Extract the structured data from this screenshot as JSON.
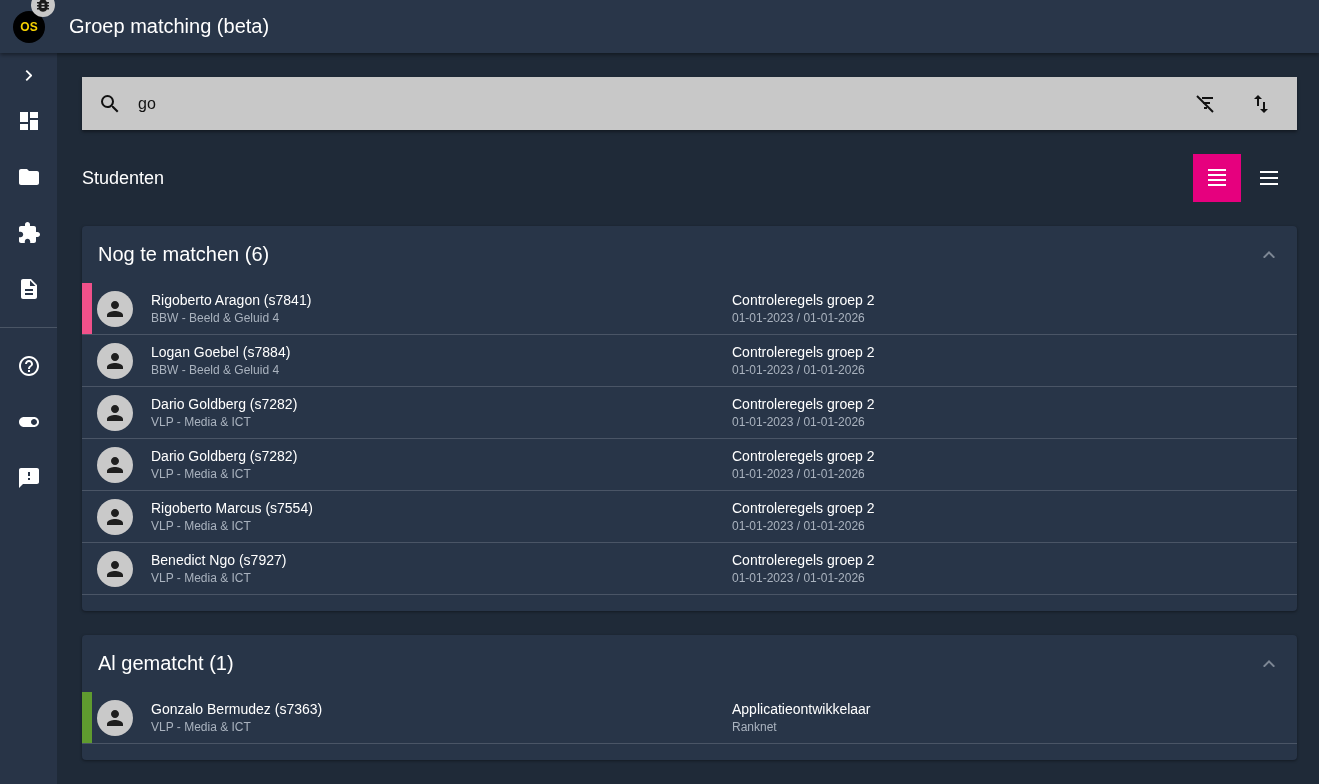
{
  "header": {
    "logo": "OS",
    "title": "Groep matching (beta)"
  },
  "search": {
    "value": "go"
  },
  "section_title": "Studenten",
  "view_toggle": [
    {
      "kind": "dense",
      "selected": true
    },
    {
      "kind": "list",
      "selected": false
    }
  ],
  "groups": [
    {
      "title": "Nog te matchen (6)",
      "expanded": true,
      "rows": [
        {
          "name": "Rigoberto Aragon (s7841)",
          "program": "BBW - Beeld & Geluid 4",
          "group": "Controleregels groep 2",
          "period": "01-01-2023 / 01-01-2026",
          "color": "#f0518a"
        },
        {
          "name": "Logan Goebel (s7884)",
          "program": "BBW - Beeld & Geluid 4",
          "group": "Controleregels groep 2",
          "period": "01-01-2023 / 01-01-2026"
        },
        {
          "name": "Dario Goldberg (s7282)",
          "program": "VLP - Media & ICT",
          "group": "Controleregels groep 2",
          "period": "01-01-2023 / 01-01-2026"
        },
        {
          "name": "Dario Goldberg (s7282)",
          "program": "VLP - Media & ICT",
          "group": "Controleregels groep 2",
          "period": "01-01-2023 / 01-01-2026"
        },
        {
          "name": "Rigoberto Marcus (s7554)",
          "program": "VLP - Media & ICT",
          "group": "Controleregels groep 2",
          "period": "01-01-2023 / 01-01-2026"
        },
        {
          "name": "Benedict Ngo (s7927)",
          "program": "VLP - Media & ICT",
          "group": "Controleregels groep 2",
          "period": "01-01-2023 / 01-01-2026"
        }
      ]
    },
    {
      "title": "Al gematcht (1)",
      "expanded": true,
      "rows": [
        {
          "name": "Gonzalo Bermudez (s7363)",
          "program": "VLP - Media & ICT",
          "group": "Applicatieontwikkelaar",
          "period": "Ranknet",
          "color": "#5f9b2f"
        }
      ]
    }
  ]
}
